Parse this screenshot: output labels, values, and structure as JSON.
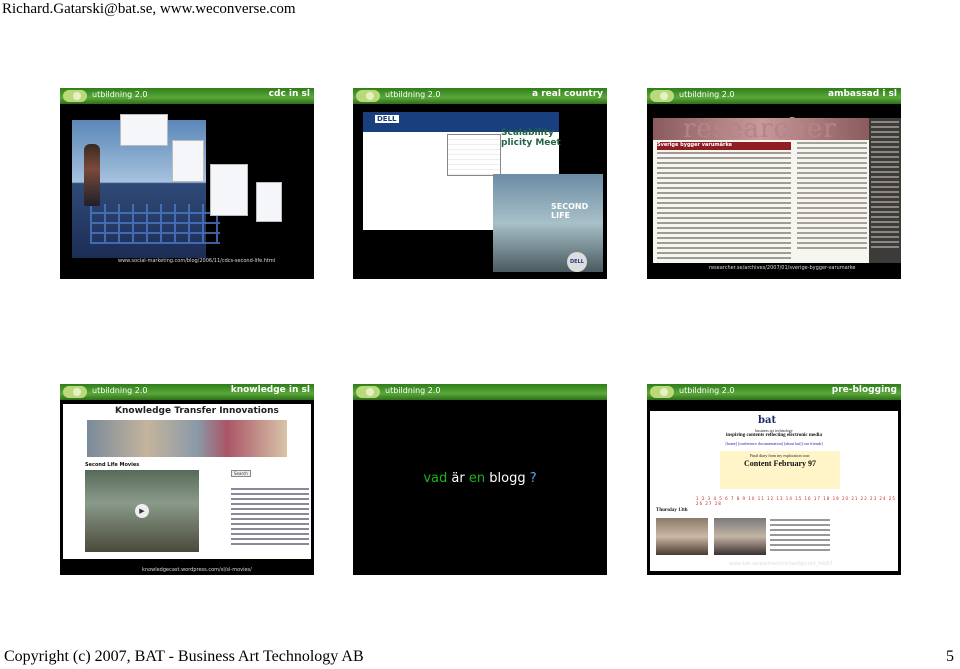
{
  "header": {
    "text": "Richard.Gatarski@bat.se, www.weconverse.com"
  },
  "footer": {
    "copyright": "Copyright (c) 2007, BAT - Business Art Technology AB",
    "page_number": "5"
  },
  "slide_header_sub": "utbildning 2.0",
  "slides": [
    {
      "title": "cdc in sl",
      "caption": "www.social-marketing.com/blog/2006/11/cdcs-second-life.html"
    },
    {
      "title": "a real country",
      "dell": {
        "logo": "DELL",
        "headline": "Scalability",
        "headline2": "plicity Meet",
        "second_life": "SECOND LIFE",
        "badge": "DELL"
      }
    },
    {
      "title": "ambassad i sl",
      "caption": "researcher.se/archives/2007/01/sverige-bygger-varumarke",
      "researcher": {
        "banner": "researcher",
        "heading": "Sverige bygger varumärke"
      }
    },
    {
      "title": "knowledge in sl",
      "caption": "knowledgecast.wordpress.com/sl/sl-movies/",
      "knowledge": {
        "title": "Knowledge Transfer Innovations",
        "subtitle": "Second Life Movies",
        "search": "Search"
      }
    },
    {
      "title": "",
      "question": {
        "w1": "vad",
        "w2": "är",
        "w3": "en",
        "w4": "blogg",
        "q": "?"
      }
    },
    {
      "title": "pre-blogging",
      "caption": "www.bat.se/partners/richardg/cont_feb97",
      "preblog": {
        "logo": "bat",
        "tagline": "business art technology",
        "header": "inspiring contents reflecting electronic media",
        "links": "[home] [conference documentation] [about bat] [our friends]",
        "date_intro": "Final diary from my exploration tour:",
        "date": "Content February 97",
        "day": "Thursday 13th"
      }
    }
  ]
}
